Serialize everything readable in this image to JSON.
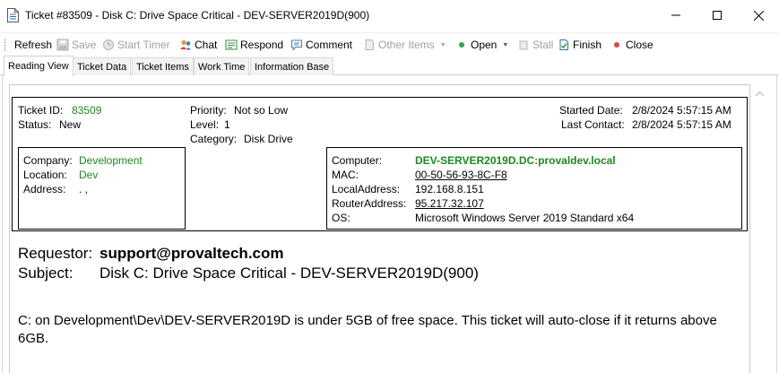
{
  "window": {
    "title": "Ticket #83509 - Disk C: Drive Space Critical - DEV-SERVER2019D(900)"
  },
  "toolbar": {
    "refresh": "Refresh",
    "save": "Save",
    "start_timer": "Start Timer",
    "chat": "Chat",
    "respond": "Respond",
    "comment": "Comment",
    "other_items": "Other Items",
    "open": "Open",
    "stall": "Stall",
    "finish": "Finish",
    "close": "Close"
  },
  "tabs": [
    {
      "label": "Reading View",
      "active": true
    },
    {
      "label": "Ticket Data"
    },
    {
      "label": "Ticket Items"
    },
    {
      "label": "Work Time"
    },
    {
      "label": "Information Base"
    }
  ],
  "ticket": {
    "id_label": "Ticket ID:",
    "id_value": "83509",
    "status_label": "Status:",
    "status_value": "New",
    "priority_label": "Priority:",
    "priority_value": "Not so Low",
    "level_label": "Level:",
    "level_value": "1",
    "category_label": "Category:",
    "category_value": "Disk Drive",
    "started_label": "Started Date:",
    "started_value": "2/8/2024 5:57:15 AM",
    "last_contact_label": "Last Contact:",
    "last_contact_value": "2/8/2024 5:57:15 AM"
  },
  "company": {
    "company_label": "Company:",
    "company_value": "Development",
    "location_label": "Location:",
    "location_value": "Dev",
    "address_label": "Address:",
    "address_value": ". ,"
  },
  "computer": {
    "computer_label": "Computer:",
    "computer_value": "DEV-SERVER2019D.DC:provaldev.local",
    "mac_label": "MAC:",
    "mac_value": "00-50-56-93-8C-F8",
    "local_label": "LocalAddress:",
    "local_value": "192.168.8.151",
    "router_label": "RouterAddress:",
    "router_value": "95.217.32.107",
    "os_label": "OS:",
    "os_value": "Microsoft Windows Server 2019 Standard x64"
  },
  "message": {
    "requestor_label": "Requestor:",
    "requestor_value": "support@provaltech.com",
    "subject_label": "Subject:",
    "subject_value": "Disk C: Drive Space Critical - DEV-SERVER2019D(900)",
    "body": "C: on Development\\Dev\\DEV-SERVER2019D is under 5GB of free space. This ticket will auto-close if it returns above 6GB."
  },
  "colors": {
    "green_value": "#1d8a1d",
    "open_dot": "#2fa84f",
    "close_dot": "#e0463c"
  }
}
